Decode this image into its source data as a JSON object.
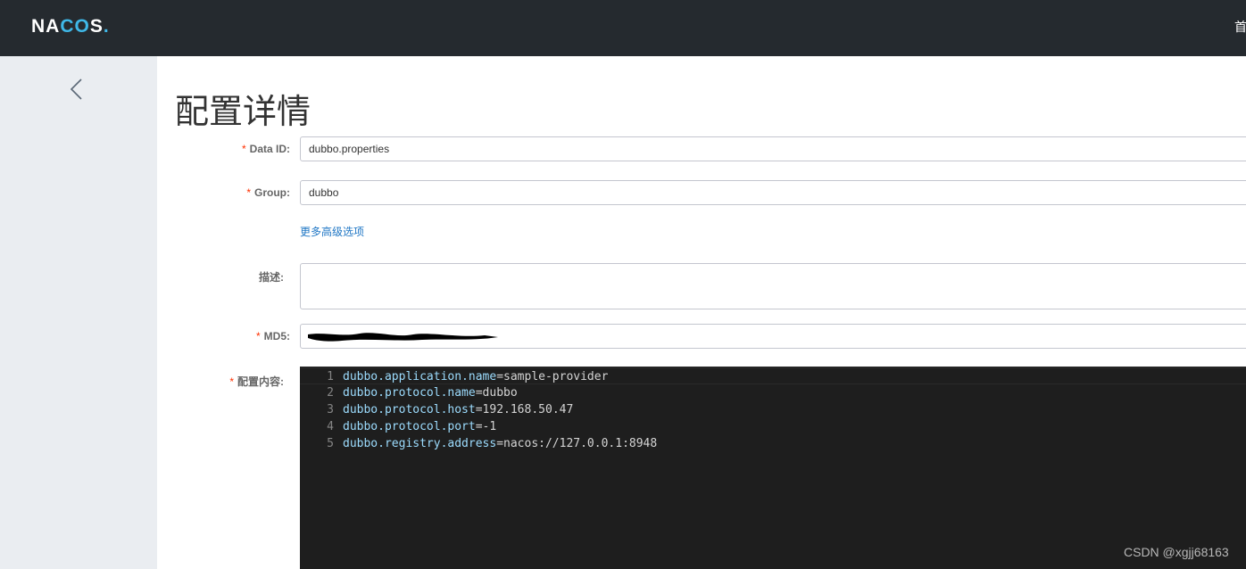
{
  "header": {
    "logo_text": "NACOS",
    "nav_first_char": "首"
  },
  "page": {
    "title": "配置详情"
  },
  "form": {
    "data_id": {
      "label": "Data ID:",
      "value": "dubbo.properties"
    },
    "group": {
      "label": "Group:",
      "value": "dubbo"
    },
    "advanced_link": "更多高级选项",
    "description": {
      "label": "描述:",
      "value": ""
    },
    "md5": {
      "label": "MD5:"
    },
    "content": {
      "label": "配置内容:"
    },
    "required_mark": "*"
  },
  "editor": {
    "lines": [
      {
        "no": "1",
        "key": "dubbo.application.name",
        "eq": "=",
        "value": "sample-provider"
      },
      {
        "no": "2",
        "key": "dubbo.protocol.name",
        "eq": "=",
        "value": "dubbo"
      },
      {
        "no": "3",
        "key": "dubbo.protocol.host",
        "eq": "=",
        "value": "192.168.50.47"
      },
      {
        "no": "4",
        "key": "dubbo.protocol.port",
        "eq": "=",
        "value": "-1"
      },
      {
        "no": "5",
        "key": "dubbo.registry.address",
        "eq": "=",
        "value": "nacos://127.0.0.1:8948"
      }
    ]
  },
  "watermark": "CSDN @xgjj68163",
  "colors": {
    "topbar": "#252a2f",
    "sidebar": "#eaedf1",
    "editor_bg": "#1e1e1e",
    "key": "#9cdcfe",
    "link": "#2077c5",
    "required": "#ff3000"
  },
  "icons": {
    "back": "chevron-left-icon"
  }
}
